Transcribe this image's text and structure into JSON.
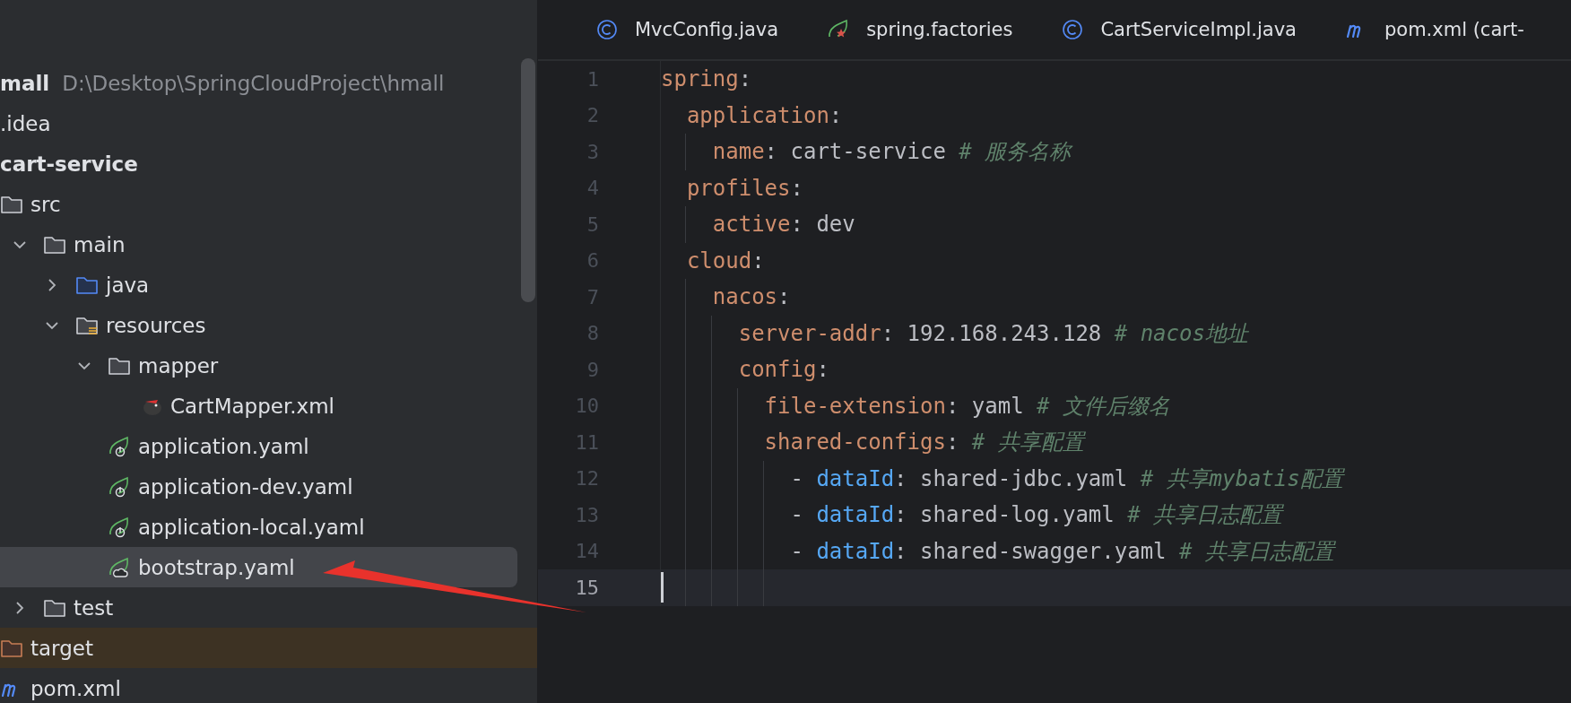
{
  "project_tree": [
    {
      "label": "mall",
      "path": "D:\\Desktop\\SpringCloudProject\\hmall",
      "kind": "project",
      "selected": false,
      "children": [
        {
          "label": ".idea",
          "kind": "folder",
          "selected": false
        },
        {
          "label": "cart-service",
          "kind": "module",
          "selected": false,
          "children": [
            {
              "label": "src",
              "kind": "folder",
              "selected": false,
              "children": [
                {
                  "label": "main",
                  "kind": "folder",
                  "expanded": true,
                  "selected": false,
                  "children": [
                    {
                      "label": "java",
                      "kind": "source-folder",
                      "expanded": false,
                      "selected": false
                    },
                    {
                      "label": "resources",
                      "kind": "resources-folder",
                      "expanded": true,
                      "selected": false,
                      "children": [
                        {
                          "label": "mapper",
                          "kind": "folder",
                          "expanded": true,
                          "selected": false,
                          "children": [
                            {
                              "label": "CartMapper.xml",
                              "kind": "mybatis",
                              "selected": false
                            }
                          ]
                        },
                        {
                          "label": "application.yaml",
                          "kind": "spring-boot",
                          "selected": false
                        },
                        {
                          "label": "application-dev.yaml",
                          "kind": "spring-boot",
                          "selected": false
                        },
                        {
                          "label": "application-local.yaml",
                          "kind": "spring-boot",
                          "selected": false
                        },
                        {
                          "label": "bootstrap.yaml",
                          "kind": "spring-cloud",
                          "selected": true
                        }
                      ]
                    }
                  ]
                },
                {
                  "label": "test",
                  "kind": "folder",
                  "expanded": false,
                  "selected": false
                }
              ]
            },
            {
              "label": "target",
              "kind": "excluded-folder",
              "selected": false
            },
            {
              "label": "pom.xml",
              "kind": "maven",
              "selected": false
            }
          ]
        }
      ]
    }
  ],
  "editor_tabs": [
    {
      "label": "MvcConfig.java",
      "kind": "class"
    },
    {
      "label": "spring.factories",
      "kind": "spring"
    },
    {
      "label": "CartServiceImpl.java",
      "kind": "class"
    },
    {
      "label": "pom.xml (cart-",
      "kind": "maven"
    }
  ],
  "code_lines": [
    {
      "number": "1",
      "current": false,
      "tokens": [
        {
          "kind": "key",
          "text": "spring"
        },
        {
          "kind": "punct",
          "text": ":"
        }
      ]
    },
    {
      "number": "2",
      "current": false,
      "tokens": [
        {
          "kind": "key",
          "text": "  application"
        },
        {
          "kind": "punct",
          "text": ":"
        }
      ]
    },
    {
      "number": "3",
      "current": false,
      "tokens": [
        {
          "kind": "key",
          "text": "    name"
        },
        {
          "kind": "punct",
          "text": ": "
        },
        {
          "kind": "value",
          "text": "cart-service "
        },
        {
          "kind": "comment",
          "text": "# 服务名称"
        }
      ]
    },
    {
      "number": "4",
      "current": false,
      "tokens": [
        {
          "kind": "key",
          "text": "  profiles"
        },
        {
          "kind": "punct",
          "text": ":"
        }
      ]
    },
    {
      "number": "5",
      "current": false,
      "tokens": [
        {
          "kind": "key",
          "text": "    active"
        },
        {
          "kind": "punct",
          "text": ": "
        },
        {
          "kind": "value",
          "text": "dev"
        }
      ]
    },
    {
      "number": "6",
      "current": false,
      "tokens": [
        {
          "kind": "key",
          "text": "  cloud"
        },
        {
          "kind": "punct",
          "text": ":"
        }
      ]
    },
    {
      "number": "7",
      "current": false,
      "tokens": [
        {
          "kind": "key",
          "text": "    nacos"
        },
        {
          "kind": "punct",
          "text": ":"
        }
      ]
    },
    {
      "number": "8",
      "current": false,
      "tokens": [
        {
          "kind": "key",
          "text": "      server-addr"
        },
        {
          "kind": "punct",
          "text": ": "
        },
        {
          "kind": "value",
          "text": "192.168.243.128 "
        },
        {
          "kind": "comment",
          "text": "# nacos地址"
        }
      ]
    },
    {
      "number": "9",
      "current": false,
      "tokens": [
        {
          "kind": "key",
          "text": "      config"
        },
        {
          "kind": "punct",
          "text": ":"
        }
      ]
    },
    {
      "number": "10",
      "current": false,
      "tokens": [
        {
          "kind": "key",
          "text": "        file-extension"
        },
        {
          "kind": "punct",
          "text": ": "
        },
        {
          "kind": "value",
          "text": "yaml "
        },
        {
          "kind": "comment",
          "text": "# 文件后缀名"
        }
      ]
    },
    {
      "number": "11",
      "current": false,
      "tokens": [
        {
          "kind": "key",
          "text": "        shared-configs"
        },
        {
          "kind": "punct",
          "text": ": "
        },
        {
          "kind": "comment",
          "text": "# 共享配置"
        }
      ]
    },
    {
      "number": "12",
      "current": false,
      "tokens": [
        {
          "kind": "punct",
          "text": "          - "
        },
        {
          "kind": "attr",
          "text": "dataId"
        },
        {
          "kind": "punct",
          "text": ": "
        },
        {
          "kind": "value",
          "text": "shared-jdbc.yaml "
        },
        {
          "kind": "comment",
          "text": "# 共享mybatis配置"
        }
      ]
    },
    {
      "number": "13",
      "current": false,
      "tokens": [
        {
          "kind": "punct",
          "text": "          - "
        },
        {
          "kind": "attr",
          "text": "dataId"
        },
        {
          "kind": "punct",
          "text": ": "
        },
        {
          "kind": "value",
          "text": "shared-log.yaml "
        },
        {
          "kind": "comment",
          "text": "# 共享日志配置"
        }
      ]
    },
    {
      "number": "14",
      "current": false,
      "tokens": [
        {
          "kind": "punct",
          "text": "          - "
        },
        {
          "kind": "attr",
          "text": "dataId"
        },
        {
          "kind": "punct",
          "text": ": "
        },
        {
          "kind": "value",
          "text": "shared-swagger.yaml "
        },
        {
          "kind": "comment",
          "text": "# 共享日志配置"
        }
      ]
    },
    {
      "number": "15",
      "current": true
    }
  ]
}
